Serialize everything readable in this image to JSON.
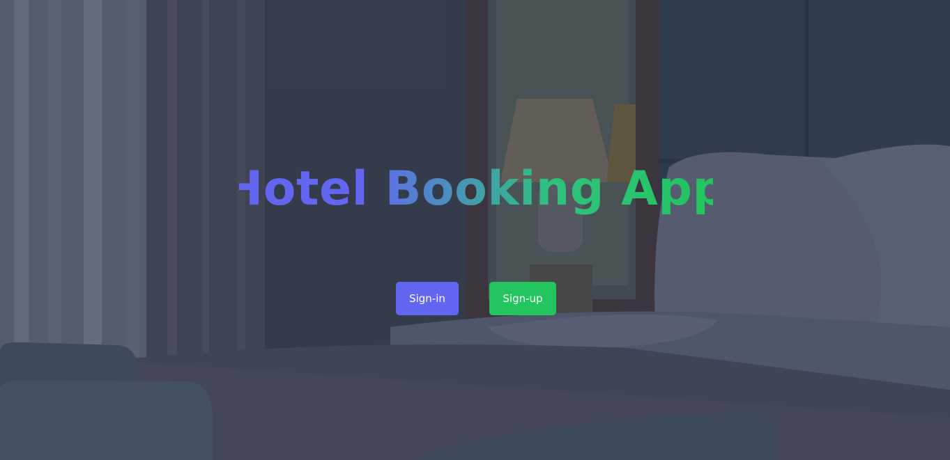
{
  "hero": {
    "title": "Hotel Booking App",
    "background_image": "dimmed hotel bedroom photo"
  },
  "actions": {
    "signin_label": "Sign-in",
    "signup_label": "Sign-up"
  },
  "colors": {
    "primary_indigo": "#6366f1",
    "accent_green": "#22c55e",
    "overlay": "#3a4354"
  }
}
